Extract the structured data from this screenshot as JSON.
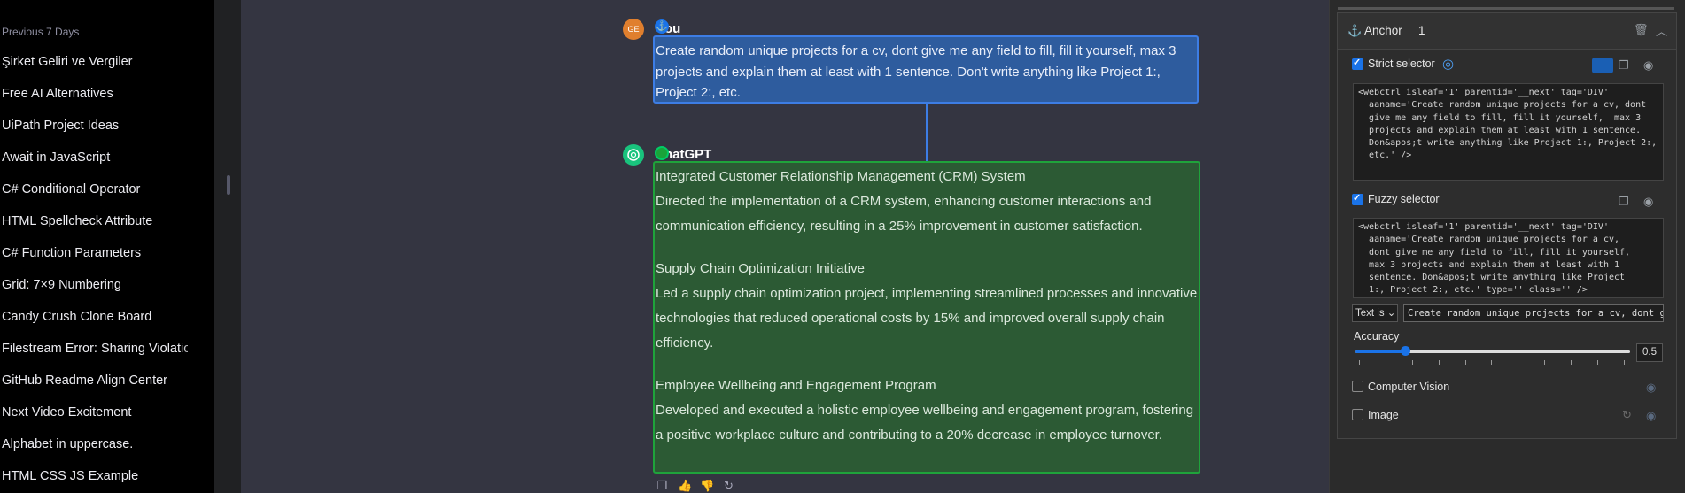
{
  "sidebar": {
    "section_label": "Previous 7 Days",
    "items": [
      "Şirket Geliri ve Vergiler",
      "Free AI Alternatives",
      "UiPath Project Ideas",
      "Await in JavaScript",
      "C# Conditional Operator",
      "HTML Spellcheck Attribute",
      "C# Function Parameters",
      "Grid: 7×9 Numbering",
      "Candy Crush Clone Board",
      "Filestream Error: Sharing Violation",
      "GitHub Readme Align Center",
      "Next Video Excitement",
      "Alphabet in uppercase.",
      "HTML CSS JS Example"
    ]
  },
  "chat": {
    "user": {
      "avatar_initials": "GE",
      "name_visible": "ou",
      "message": "Create random unique projects for a cv, dont give me any field to fill, fill it yourself,  max 3 projects and explain them at least with 1 sentence. Don't write anything like Project 1:, Project 2:, etc."
    },
    "assistant": {
      "name_visible": "hatGPT",
      "projects": [
        {
          "title": "Integrated Customer Relationship Management (CRM) System",
          "description": "Directed the implementation of a CRM system, enhancing customer interactions and communication efficiency, resulting in a 25% improvement in customer satisfaction."
        },
        {
          "title": "Supply Chain Optimization Initiative",
          "description": "Led a supply chain optimization project, implementing streamlined processes and innovative technologies that reduced operational costs by 15% and improved overall supply chain efficiency."
        },
        {
          "title": "Employee Wellbeing and Engagement Program",
          "description": "Developed and executed a holistic employee wellbeing and engagement program, fostering a positive workplace culture and contributing to a 20% decrease in employee turnover."
        }
      ]
    }
  },
  "panel": {
    "anchor_title": "Anchor",
    "anchor_count": "1",
    "strict": {
      "label": "Strict selector",
      "checked": true,
      "code": "<webctrl isleaf='1' parentid='__next' tag='DIV'\n  aaname='Create random unique projects for a cv, dont\n  give me any field to fill, fill it yourself,  max 3\n  projects and explain them at least with 1 sentence.\n  Don&apos;t write anything like Project 1:, Project 2:,\n  etc.' />"
    },
    "fuzzy": {
      "label": "Fuzzy selector",
      "checked": true,
      "code": "<webctrl isleaf='1' parentid='__next' tag='DIV'\n  aaname='Create random unique projects for a cv,\n  dont give me any field to fill, fill it yourself,\n  max 3 projects and explain them at least with 1\n  sentence. Don&apos;t write anything like Project\n  1:, Project 2:, etc.' type='' class='' />",
      "match_mode": "Text is",
      "text_value": "Create random unique projects for a cv, dont give me any field to fill",
      "accuracy_label": "Accuracy",
      "accuracy_value": "0.5",
      "accuracy_fraction": 0.18
    },
    "computer_vision": {
      "label": "Computer Vision",
      "checked": false
    },
    "image": {
      "label": "Image",
      "checked": false
    },
    "colors": {
      "accent": "#1a73e8",
      "user_highlight": "#2e5c9e",
      "assistant_highlight": "#2c5a34"
    }
  }
}
